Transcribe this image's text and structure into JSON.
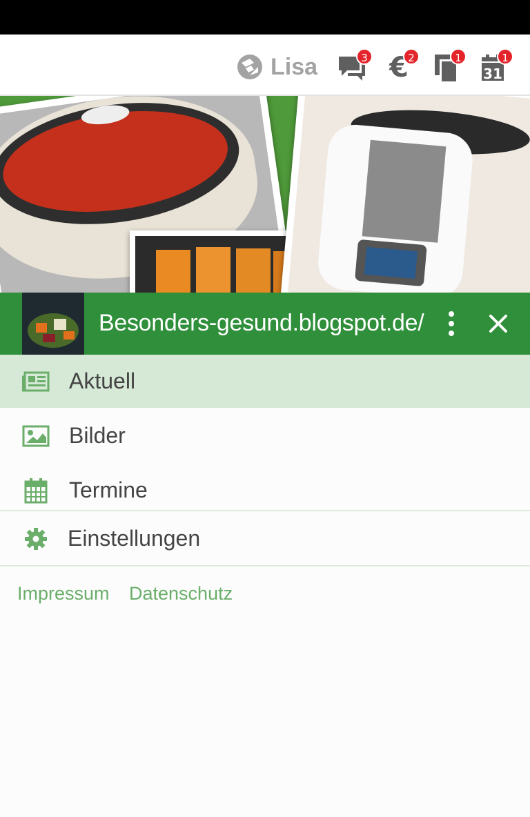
{
  "user": {
    "name": "Lisa",
    "icon": "logo-icon"
  },
  "toolbar": {
    "messages": {
      "icon": "chat-icon",
      "badge": "3"
    },
    "payments": {
      "icon": "euro-icon",
      "symbol": "€",
      "badge": "2"
    },
    "documents": {
      "icon": "documents-icon",
      "badge": "1"
    },
    "calendar": {
      "icon": "calendar-icon",
      "day": "31",
      "badge": "1"
    }
  },
  "page": {
    "title": "Besonders-gesund.blogspot.de/"
  },
  "menu": {
    "items": [
      {
        "label": "Aktuell",
        "icon": "newspaper-icon",
        "active": true
      },
      {
        "label": "Bilder",
        "icon": "image-icon"
      },
      {
        "label": "Termine",
        "icon": "calendar-icon"
      },
      {
        "label": "Einstellungen",
        "icon": "gear-icon"
      }
    ]
  },
  "footer": {
    "impressum": "Impressum",
    "datenschutz": "Datenschutz"
  },
  "colors": {
    "accent": "#2f8f3a",
    "active_bg": "#d6e8d6",
    "badge": "#e3242b",
    "link": "#6aae6a"
  }
}
